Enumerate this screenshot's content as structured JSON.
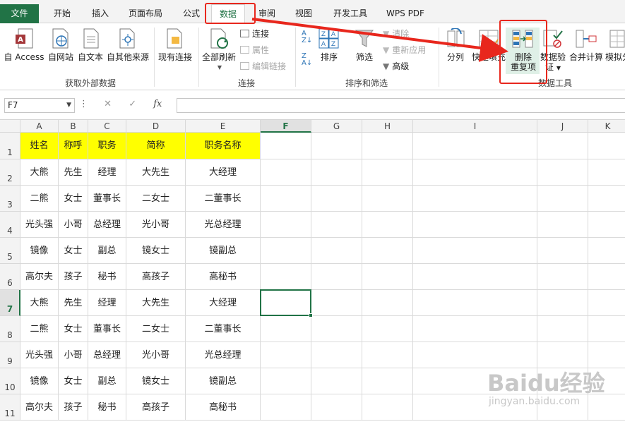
{
  "tabs": {
    "file": "文件",
    "start": "开始",
    "insert": "插入",
    "layout": "页面布局",
    "formula": "公式",
    "data": "数据",
    "review": "审阅",
    "view": "视图",
    "dev": "开发工具",
    "pdf": "WPS PDF"
  },
  "ribbon": {
    "access": "自 Access",
    "web": "自网站",
    "text": "自文本",
    "other": "自其他来源",
    "existing": "现有连接",
    "group_external": "获取外部数据",
    "refresh_all": "全部刷新",
    "connections": "连接",
    "properties": "属性",
    "edit_links": "编辑链接",
    "group_connections": "连接",
    "sort": "排序",
    "filter": "筛选",
    "clear": "清除",
    "reapply": "重新应用",
    "advanced": "高级",
    "group_sort": "排序和筛选",
    "text_to_columns": "分列",
    "flash_fill": "快速填充",
    "remove_dup_line1": "删除",
    "remove_dup_line2": "重复项",
    "validation_line1": "数据验",
    "validation_line2": "证",
    "consolidate": "合并计算",
    "whatif": "模拟分",
    "group_tools": "数据工具"
  },
  "formula_bar": {
    "name_box": "F7",
    "fx": "fx"
  },
  "columns": [
    "A",
    "B",
    "C",
    "D",
    "E",
    "F",
    "G",
    "H",
    "I",
    "J",
    "K"
  ],
  "rows": [
    "1",
    "2",
    "3",
    "4",
    "5",
    "6",
    "7",
    "8",
    "9",
    "10",
    "11"
  ],
  "table": {
    "header": [
      "姓名",
      "称呼",
      "职务",
      "简称",
      "职务名称"
    ],
    "body": [
      [
        "大熊",
        "先生",
        "经理",
        "大先生",
        "大经理"
      ],
      [
        "二熊",
        "女士",
        "董事长",
        "二女士",
        "二董事长"
      ],
      [
        "光头强",
        "小哥",
        "总经理",
        "光小哥",
        "光总经理"
      ],
      [
        "镜像",
        "女士",
        "副总",
        "镜女士",
        "镜副总"
      ],
      [
        "高尔夫",
        "孩子",
        "秘书",
        "高孩子",
        "高秘书"
      ],
      [
        "大熊",
        "先生",
        "经理",
        "大先生",
        "大经理"
      ],
      [
        "二熊",
        "女士",
        "董事长",
        "二女士",
        "二董事长"
      ],
      [
        "光头强",
        "小哥",
        "总经理",
        "光小哥",
        "光总经理"
      ],
      [
        "镜像",
        "女士",
        "副总",
        "镜女士",
        "镜副总"
      ],
      [
        "高尔夫",
        "孩子",
        "秘书",
        "高孩子",
        "高秘书"
      ]
    ]
  },
  "watermark": {
    "brand": "Baidu经验",
    "url": "jingyan.baidu.com"
  },
  "colors": {
    "accent": "#217346",
    "header_fill": "#ffff00",
    "annotation": "#e8271d"
  }
}
